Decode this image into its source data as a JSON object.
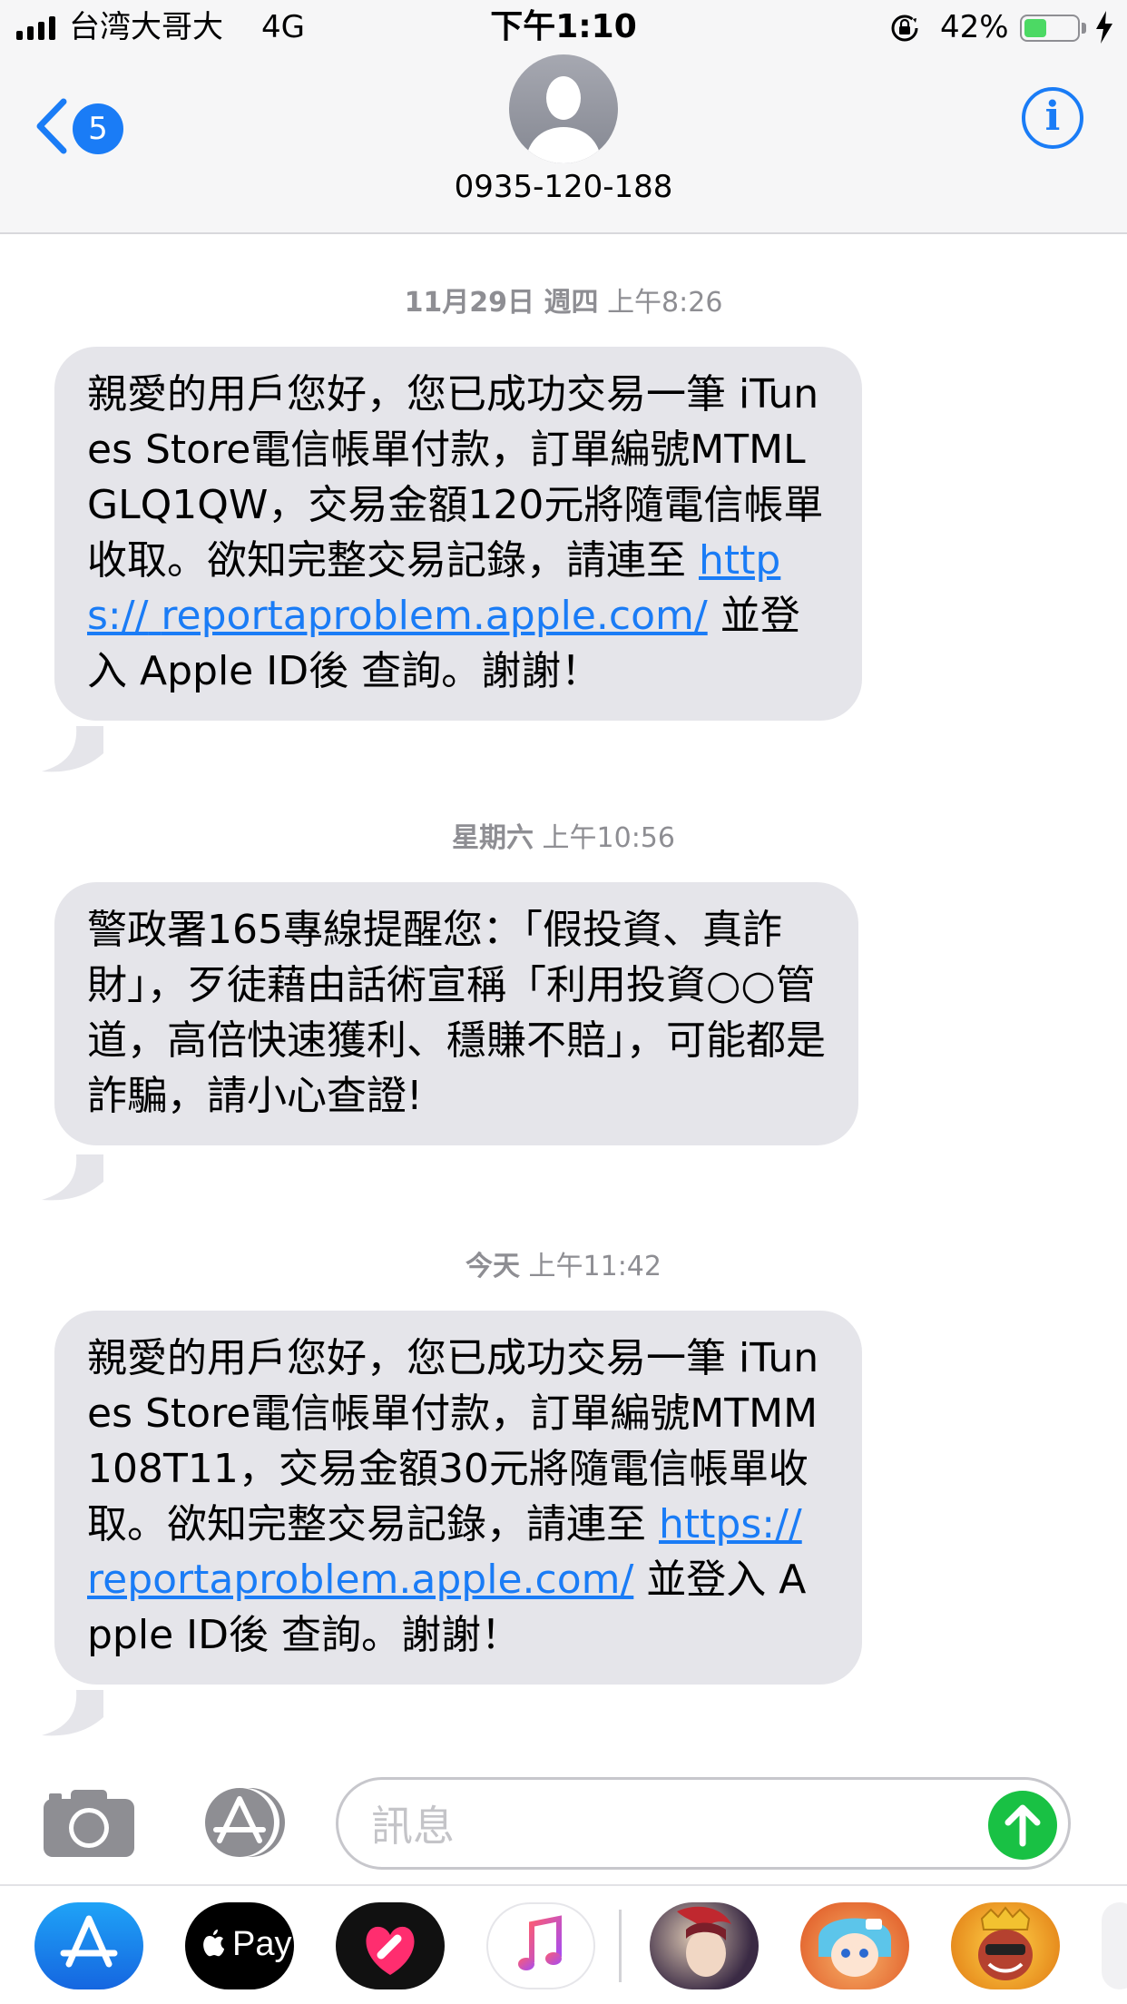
{
  "status_bar": {
    "carrier": "台湾大哥大",
    "network": "4G",
    "time": "下午1:10",
    "battery_percent": "42%",
    "battery_level": 0.42,
    "battery_color": "#4cd964",
    "icons": [
      "signal-bars-icon",
      "orientation-lock-icon",
      "battery-icon",
      "charging-bolt-icon"
    ]
  },
  "header": {
    "back_badge": "5",
    "contact": "0935-120-188",
    "info_icon": "i",
    "accent_color": "#1a7cf6"
  },
  "conversation": [
    {
      "timestamp_date": "11月29日 週四",
      "timestamp_time": "上午8:26",
      "text_before_link": "親愛的用戶您好，您已成功交易一筆 iTunes Store電信帳單付款，訂單編號MTMLGLQ1QW，交易金額120元將隨電信帳單收取。欲知完整交易記錄，請連至 ",
      "link_line1": "https://",
      "link_line2": "reportaproblem.apple.com/",
      "text_after_link": " 並登入 Apple ID後 查詢。謝謝！"
    },
    {
      "timestamp_date": "星期六",
      "timestamp_time": "上午10:56",
      "text": "警政署165專線提醒您：「假投資、真詐財」，歹徒藉由話術宣稱「利用投資○○管道，高倍快速獲利、穩賺不賠」，可能都是詐騙，請小心查證!"
    },
    {
      "timestamp_date": "今天",
      "timestamp_time": "上午11:42",
      "text_before_link": "親愛的用戶您好，您已成功交易一筆 iTunes Store電信帳單付款，訂單編號MTMM108T11，交易金額30元將隨電信帳單收取。欲知完整交易記錄，請連至 ",
      "link_line1": "https://",
      "link_line2": "reportaproblem.apple.com/",
      "text_after_link": " 並登入 Apple ID後 查詢。謝謝！"
    }
  ],
  "input_bar": {
    "placeholder": "訊息",
    "send_color": "#19c144"
  },
  "app_drawer": {
    "apps": [
      "app-store-icon",
      "apple-pay-icon",
      "digital-touch-icon",
      "music-icon",
      "game-app-icon-1",
      "game-app-icon-2",
      "game-app-icon-3"
    ],
    "apple_pay_label": "Pay"
  }
}
